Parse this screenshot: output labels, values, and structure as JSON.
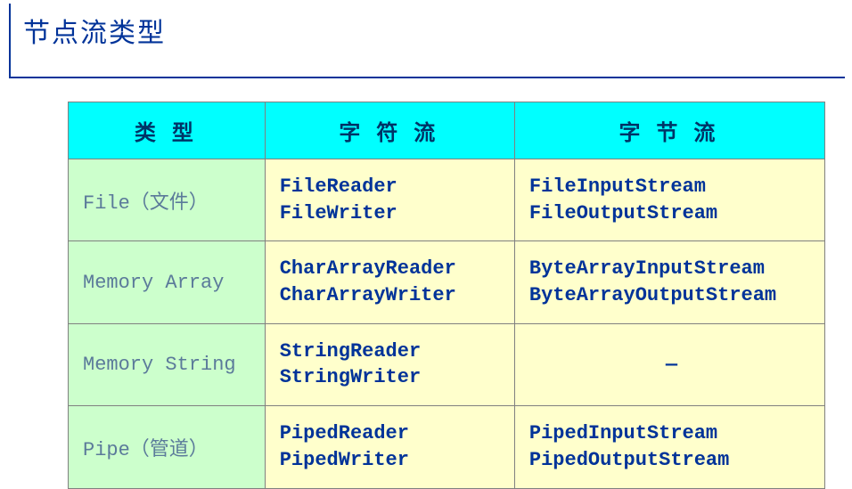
{
  "title": "节点流类型",
  "headers": {
    "c1": "类   型",
    "c2": "字 符 流",
    "c3": "字 节 流"
  },
  "rows": [
    {
      "type": "File（文件）",
      "char1": "FileReader",
      "char2": "FileWriter",
      "byte1": "FileInputStream",
      "byte2": "FileOutputStream"
    },
    {
      "type": "Memory Array",
      "char1": "CharArrayReader",
      "char2": "CharArrayWriter",
      "byte1": "ByteArrayInputStream",
      "byte2": "ByteArrayOutputStream"
    },
    {
      "type": "Memory String",
      "char1": "StringReader",
      "char2": "StringWriter",
      "byte1": "—",
      "byte2": ""
    },
    {
      "type": "Pipe（管道）",
      "char1": "PipedReader",
      "char2": "PipedWriter",
      "byte1": "PipedInputStream",
      "byte2": "PipedOutputStream"
    }
  ],
  "chart_data": {
    "type": "table",
    "title": "节点流类型",
    "columns": [
      "类 型",
      "字 符 流",
      "字 节 流"
    ],
    "data": [
      [
        "File（文件）",
        "FileReader / FileWriter",
        "FileInputStream / FileOutputStream"
      ],
      [
        "Memory Array",
        "CharArrayReader / CharArrayWriter",
        "ByteArrayInputStream / ByteArrayOutputStream"
      ],
      [
        "Memory String",
        "StringReader / StringWriter",
        "—"
      ],
      [
        "Pipe（管道）",
        "PipedReader / PipedWriter",
        "PipedInputStream / PipedOutputStream"
      ]
    ]
  }
}
